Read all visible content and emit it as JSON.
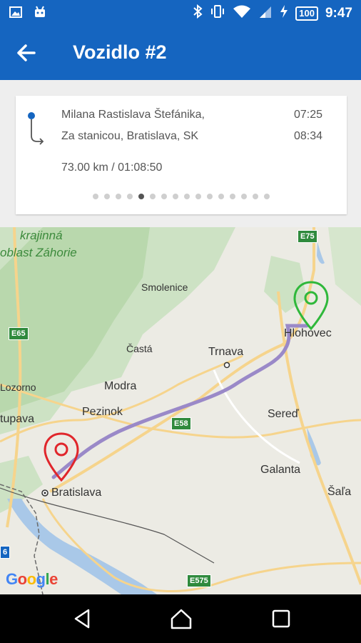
{
  "status_bar": {
    "battery": "100",
    "time": "9:47"
  },
  "app_bar": {
    "title": "Vozidlo #2"
  },
  "trip": {
    "start_address": "Milana Rastislava Štefánika,",
    "end_address": "Za stanicou, Bratislava, SK",
    "start_time": "07:25",
    "end_time": "08:34",
    "distance_duration": "73.00 km /  01:08:50",
    "page_dots": 16,
    "active_dot": 4
  },
  "map": {
    "labels": {
      "krajinna": "krajinná",
      "oblast": "oblast Záhorie",
      "smolenice": "Smolenice",
      "casta": "Častá",
      "trnava": "Trnava",
      "hlohovec": "Hlohovec",
      "lozorno": "Lozorno",
      "modra": "Modra",
      "stupava": "tupava",
      "pezinok": "Pezinok",
      "sered": "Sereď",
      "bratislava": "Bratislava",
      "galanta": "Galanta",
      "sala": "Šaľa"
    },
    "roads": {
      "e75": "E75",
      "e65": "E65",
      "e58": "E58",
      "e575": "E575",
      "left6": "6"
    },
    "logo": "Google",
    "colors": {
      "start_marker": "#2fb83b",
      "end_marker": "#e0262b",
      "route": "#9a89c8"
    }
  }
}
